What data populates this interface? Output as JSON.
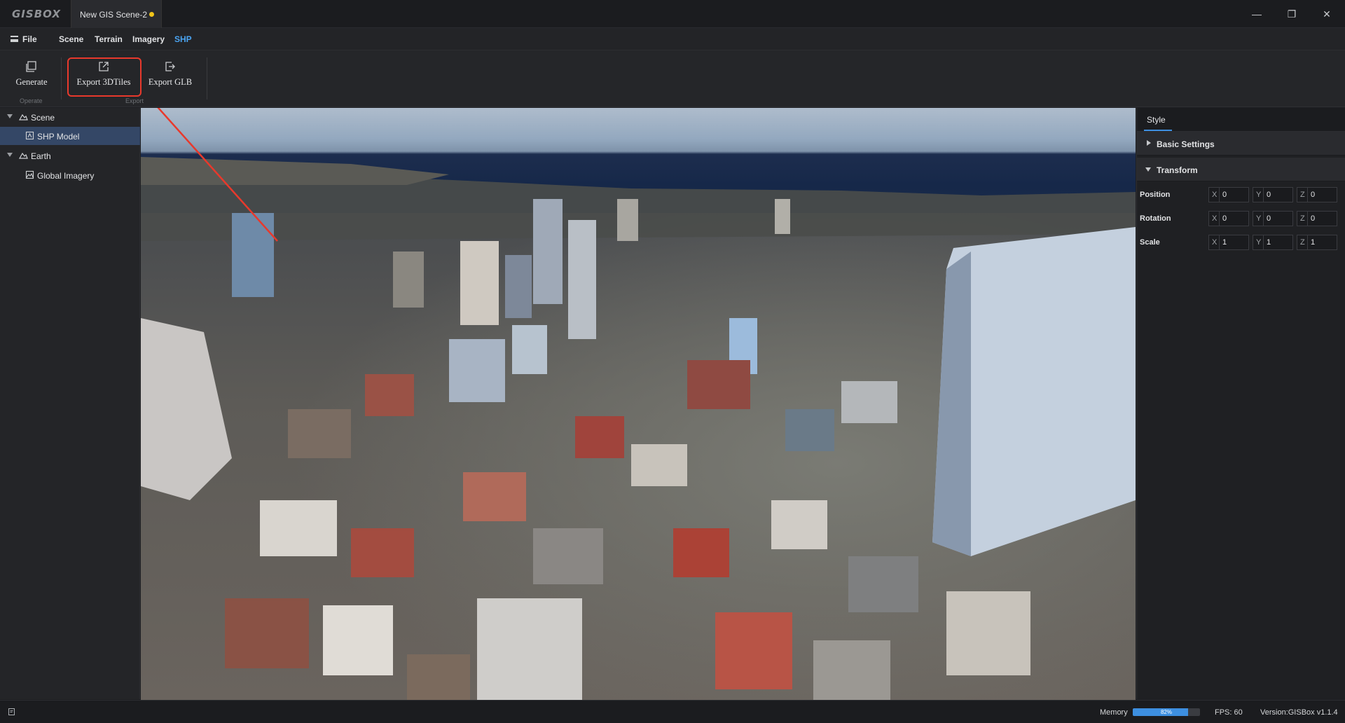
{
  "app": {
    "logo": "GISBOX",
    "document_tab": "New GIS Scene-2",
    "unsaved_dot_color": "#f0c419"
  },
  "window_controls": {
    "minimize": "—",
    "restore": "❐",
    "close": "✕"
  },
  "menu": {
    "file": "File",
    "items": [
      "Scene",
      "Terrain",
      "Imagery",
      "SHP"
    ],
    "active": "SHP"
  },
  "ribbon": {
    "buttons": [
      {
        "label": "Generate",
        "icon": "generate-icon"
      },
      {
        "label": "Export 3DTiles",
        "icon": "export-3dtiles-icon"
      },
      {
        "label": "Export GLB",
        "icon": "export-glb-icon"
      }
    ],
    "groups": [
      "Operate",
      "Export"
    ]
  },
  "tree": [
    {
      "label": "Scene",
      "icon": "scene-icon",
      "expanded": true,
      "level": 0
    },
    {
      "label": "SHP Model",
      "icon": "model-icon",
      "level": 1,
      "selected": true
    },
    {
      "label": "Earth",
      "icon": "earth-icon",
      "expanded": true,
      "level": 0
    },
    {
      "label": "Global Imagery",
      "icon": "imagery-icon",
      "level": 1
    }
  ],
  "panel": {
    "tab": "Style",
    "sections": {
      "basic": "Basic Settings",
      "transform": "Transform"
    },
    "rows": [
      {
        "label": "Position",
        "x": "0",
        "y": "0",
        "z": "0"
      },
      {
        "label": "Rotation",
        "x": "0",
        "y": "0",
        "z": "0"
      },
      {
        "label": "Scale",
        "x": "1",
        "y": "1",
        "z": "1"
      }
    ],
    "axis_labels": [
      "X",
      "Y",
      "Z"
    ]
  },
  "status": {
    "memory_label": "Memory",
    "memory_percent": 82,
    "memory_text": "82%",
    "fps": "FPS: 60",
    "version": "Version:GISBox v1.1.4"
  },
  "colors": {
    "accent": "#3d8fe0",
    "highlight": "#e8392c",
    "selected_row": "#344766"
  }
}
